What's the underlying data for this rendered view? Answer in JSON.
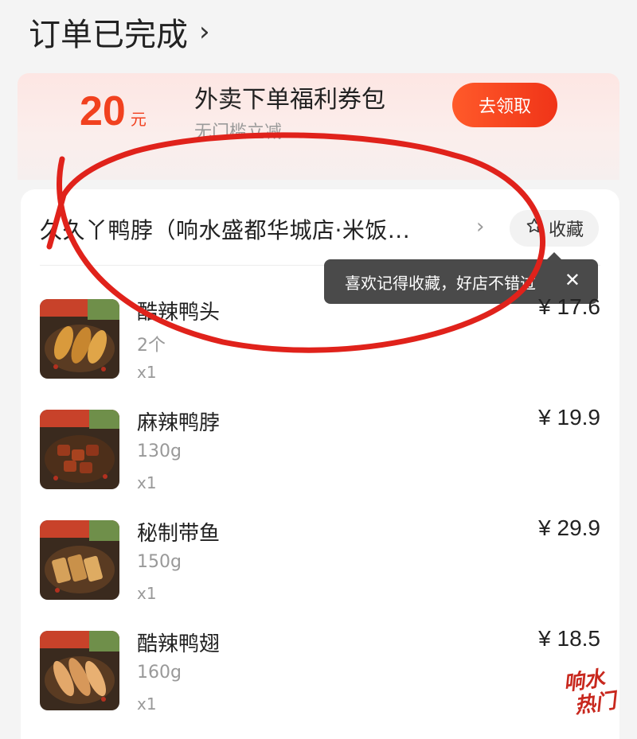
{
  "order_status": {
    "title": "订单已完成",
    "chevron_icon": "chevron-right-icon"
  },
  "coupon": {
    "amount": "20",
    "unit": "元",
    "title": "外卖下单福利券包",
    "subtitle": "无门槛立减",
    "button_label": "去领取",
    "accent_color": "#f1411f"
  },
  "store": {
    "name": "久久丫鸭脖（响水盛都华城店·米饭...",
    "chevron_icon": "chevron-right-icon",
    "favorite_label": "收藏",
    "favorite_icon": "star-outline-icon"
  },
  "tooltip": {
    "text": "喜欢记得收藏，好店不错过",
    "close_label": "✕"
  },
  "items": [
    {
      "name": "酷辣鸭头",
      "spec": "2个",
      "qty": "x1",
      "price": "¥ 17.6"
    },
    {
      "name": "麻辣鸭脖",
      "spec": "130g",
      "qty": "x1",
      "price": "¥ 19.9"
    },
    {
      "name": "秘制带鱼",
      "spec": "150g",
      "qty": "x1",
      "price": "¥ 29.9"
    },
    {
      "name": "酷辣鸭翅",
      "spec": "160g",
      "qty": "x1",
      "price": "¥ 18.5"
    }
  ],
  "annotation": {
    "type": "hand-drawn-circle",
    "color": "#e0221b"
  },
  "watermark": {
    "line1": "响水",
    "line2": "热门",
    "color": "#c8281e"
  }
}
